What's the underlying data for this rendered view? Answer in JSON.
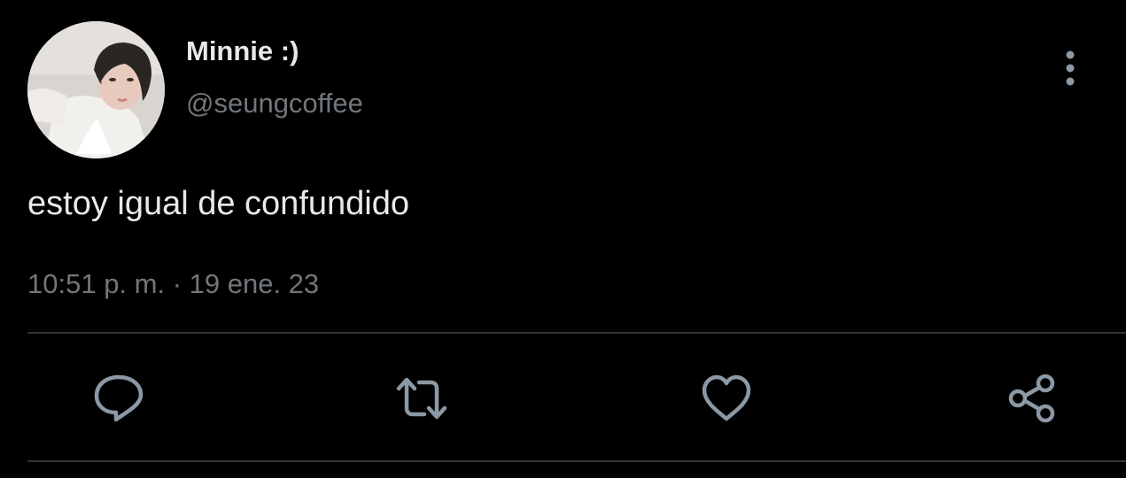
{
  "tweet": {
    "display_name": "Minnie :)",
    "handle": "@seungcoffee",
    "text": "estoy igual de confundido",
    "timestamp": "10:51 p. m. · 19 ene. 23"
  },
  "icons": {
    "more": "more-vertical-icon",
    "reply": "reply-icon",
    "retweet": "retweet-icon",
    "like": "heart-icon",
    "share": "share-icon"
  },
  "colors": {
    "background": "#000000",
    "primary_text": "#e7e9ea",
    "secondary_text": "#71767b",
    "divider": "#2f3336",
    "icon": "#8b98a5"
  }
}
